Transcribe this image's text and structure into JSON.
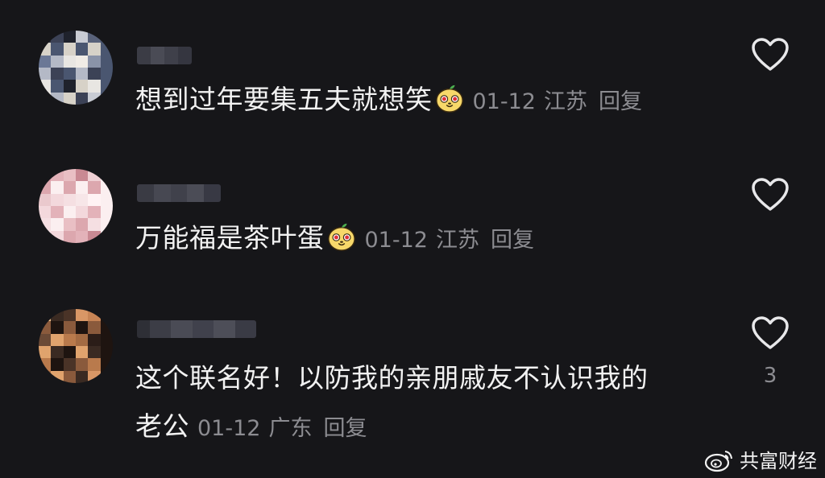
{
  "comments": [
    {
      "text": "想到过年要集五夫就想笑",
      "emoji": "apple-face-emoji",
      "date": "01-12",
      "location": "江苏",
      "reply_label": "回复",
      "likes": ""
    },
    {
      "text": "万能福是茶叶蛋",
      "emoji": "apple-face-emoji",
      "date": "01-12",
      "location": "江苏",
      "reply_label": "回复",
      "likes": ""
    },
    {
      "text_line1": "这个联名好！以防我的亲朋戚友不认识我的",
      "text_line2": "老公",
      "date": "01-12",
      "location": "广东",
      "reply_label": "回复",
      "likes": "3"
    }
  ],
  "icons": {
    "like": "heart-outline-icon",
    "watermark_logo": "weibo-logo-icon"
  },
  "watermark": {
    "text": "共富财经"
  },
  "colors": {
    "background": "#161619",
    "primary_text": "#f2f2f2",
    "secondary_text": "#8c8c91"
  }
}
